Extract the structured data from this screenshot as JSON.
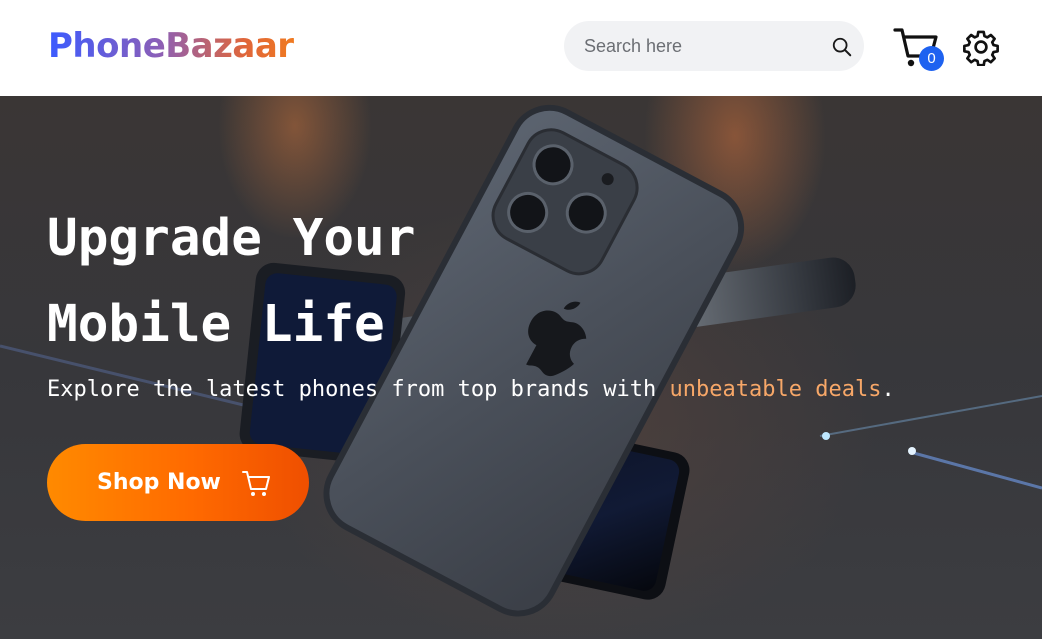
{
  "header": {
    "logo": "PhoneBazaar",
    "search": {
      "placeholder": "Search here",
      "value": ""
    },
    "cart": {
      "count": "0",
      "icon": "cart-icon"
    },
    "settings": {
      "icon": "gear-icon"
    }
  },
  "hero": {
    "title_line_1": "Upgrade Your",
    "title_line_2": "Mobile Life",
    "subtitle_prefix": "Explore the latest phones from top brands with ",
    "subtitle_highlight": "unbeatable deals",
    "subtitle_suffix": ".",
    "cta_label": "Shop Now",
    "cta_icon": "cart-icon"
  },
  "colors": {
    "accent_orange": "#ff7a00",
    "highlight": "#f7a768",
    "badge_blue": "#1e62f0",
    "logo_gradient": [
      "#3b5bff",
      "#f07a20"
    ]
  }
}
